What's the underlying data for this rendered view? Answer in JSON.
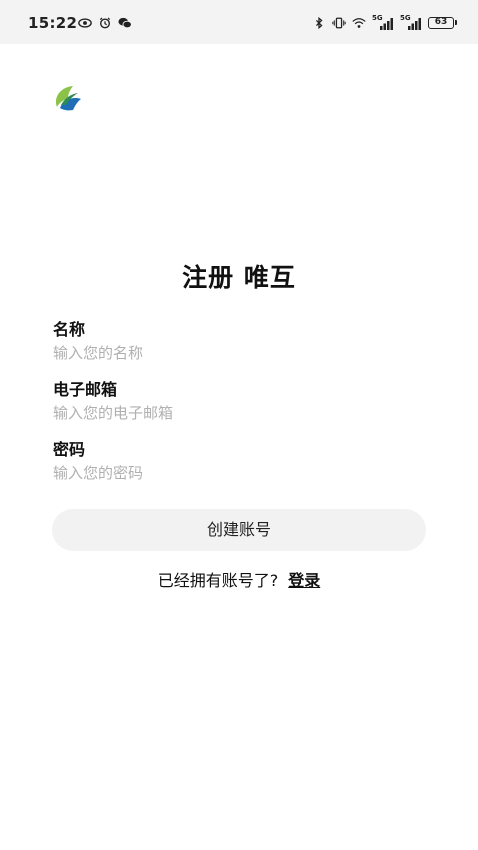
{
  "status_bar": {
    "time": "15:22",
    "battery": "63",
    "signal_label_1": "5G",
    "signal_label_2": "5G",
    "left_icons": [
      "eye-icon",
      "alarm-icon",
      "wechat-icon"
    ],
    "right_icons": [
      "bluetooth-icon",
      "vibrate-icon",
      "wifi-icon",
      "signal-5g-icon",
      "signal-5g-icon",
      "battery-icon"
    ]
  },
  "logo": {
    "icon": "app-logo-icon",
    "colors": [
      "#2e8b57",
      "#1e6fb8",
      "#8bc34a"
    ]
  },
  "title": "注册 唯互",
  "form": {
    "name": {
      "label": "名称",
      "placeholder": "输入您的名称",
      "value": ""
    },
    "email": {
      "label": "电子邮箱",
      "placeholder": "输入您的电子邮箱",
      "value": ""
    },
    "password": {
      "label": "密码",
      "placeholder": "输入您的密码",
      "value": ""
    },
    "submit_label": "创建账号"
  },
  "login": {
    "prompt": "已经拥有账号了?",
    "link_label": "登录"
  }
}
